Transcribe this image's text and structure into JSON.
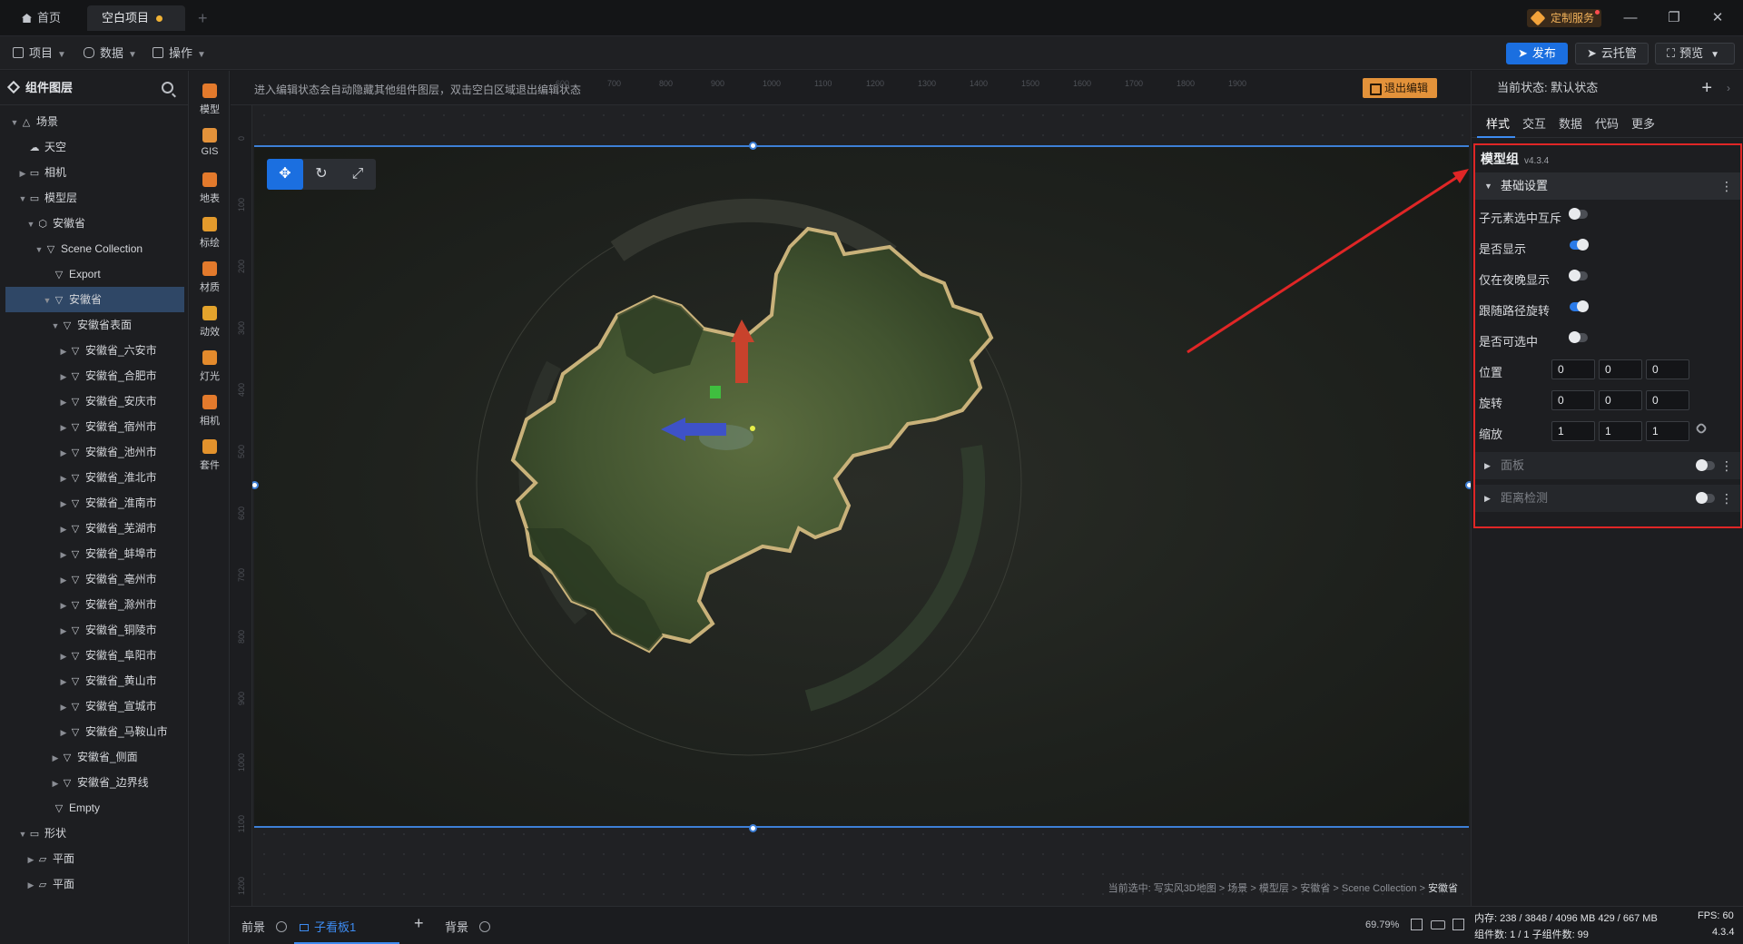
{
  "titlebar": {
    "home_tab": "首页",
    "project_tab": "空白项目",
    "add_tab": "+",
    "custom_service": "定制服务",
    "minimize": "—",
    "restore": "❐",
    "close": "✕",
    "colors": {
      "accent": "#1b6fe0",
      "unsaved_dot": "#f0b235"
    }
  },
  "menubar": {
    "project": "项目",
    "data": "数据",
    "operation": "操作",
    "publish": "发布",
    "cloud": "云托管",
    "preview": "预览"
  },
  "layer_panel": {
    "title": "组件图层",
    "items": [
      {
        "label": "场景",
        "arrow": "▼",
        "icon": "△"
      },
      {
        "label": "天空",
        "arrow": "",
        "icon": "☁"
      },
      {
        "label": "相机",
        "arrow": "▶",
        "icon": "▭"
      },
      {
        "label": "模型层",
        "arrow": "▼",
        "icon": "▭"
      },
      {
        "label": "安徽省",
        "arrow": "▼",
        "icon": "⬡"
      },
      {
        "label": "Scene Collection",
        "arrow": "▼",
        "icon": "▽"
      },
      {
        "label": "Export",
        "arrow": "",
        "icon": "▽"
      },
      {
        "label": "安徽省",
        "arrow": "▼",
        "icon": "▽"
      },
      {
        "label": "安徽省表面",
        "arrow": "▼",
        "icon": "▽"
      },
      {
        "label": "安徽省_六安市",
        "arrow": "▶",
        "icon": "▽"
      },
      {
        "label": "安徽省_合肥市",
        "arrow": "▶",
        "icon": "▽"
      },
      {
        "label": "安徽省_安庆市",
        "arrow": "▶",
        "icon": "▽"
      },
      {
        "label": "安徽省_宿州市",
        "arrow": "▶",
        "icon": "▽"
      },
      {
        "label": "安徽省_池州市",
        "arrow": "▶",
        "icon": "▽"
      },
      {
        "label": "安徽省_淮北市",
        "arrow": "▶",
        "icon": "▽"
      },
      {
        "label": "安徽省_淮南市",
        "arrow": "▶",
        "icon": "▽"
      },
      {
        "label": "安徽省_芜湖市",
        "arrow": "▶",
        "icon": "▽"
      },
      {
        "label": "安徽省_蚌埠市",
        "arrow": "▶",
        "icon": "▽"
      },
      {
        "label": "安徽省_亳州市",
        "arrow": "▶",
        "icon": "▽"
      },
      {
        "label": "安徽省_滁州市",
        "arrow": "▶",
        "icon": "▽"
      },
      {
        "label": "安徽省_铜陵市",
        "arrow": "▶",
        "icon": "▽"
      },
      {
        "label": "安徽省_阜阳市",
        "arrow": "▶",
        "icon": "▽"
      },
      {
        "label": "安徽省_黄山市",
        "arrow": "▶",
        "icon": "▽"
      },
      {
        "label": "安徽省_宣城市",
        "arrow": "▶",
        "icon": "▽"
      },
      {
        "label": "安徽省_马鞍山市",
        "arrow": "▶",
        "icon": "▽"
      },
      {
        "label": "安徽省_侧面",
        "arrow": "▶",
        "icon": "▽"
      },
      {
        "label": "安徽省_边界线",
        "arrow": "▶",
        "icon": "▽"
      },
      {
        "label": "Empty",
        "arrow": "",
        "icon": "▽"
      },
      {
        "label": "形状",
        "arrow": "▼",
        "icon": "▭"
      },
      {
        "label": "平面",
        "arrow": "▶",
        "icon": "▱"
      },
      {
        "label": "平面",
        "arrow": "▶",
        "icon": "▱"
      }
    ]
  },
  "toolbox": [
    "模型",
    "GIS",
    "地表",
    "标绘",
    "材质",
    "动效",
    "灯光",
    "相机",
    "套件"
  ],
  "canvas": {
    "edit_hint": "进入编辑状态会自动隐藏其他组件图层，双击空白区域退出编辑状态",
    "exit_edit": "退出编辑",
    "ruler_top": [
      "600",
      "700",
      "800",
      "900",
      "1000",
      "1100",
      "1200",
      "1300",
      "1400",
      "1500",
      "1600",
      "1700",
      "1800",
      "1900"
    ],
    "ruler_left": [
      "0",
      "100",
      "200",
      "300",
      "400",
      "500",
      "600",
      "700",
      "800",
      "900",
      "1000",
      "1100",
      "1200"
    ],
    "breadcrumb_prefix": "当前选中: 写实风3D地图 > 场景 > 模型层 > 安徽省 > Scene Collection >",
    "breadcrumb_current": "安徽省"
  },
  "bottombar": {
    "foreground": "前景",
    "subboard": "子看板1",
    "add": "+",
    "background": "背景",
    "zoom": "69.79%"
  },
  "right_panel": {
    "state_label": "当前状态:  默认状态",
    "tabs": [
      "样式",
      "交互",
      "数据",
      "代码",
      "更多"
    ],
    "component_title": "模型组",
    "version": "v4.3.4",
    "section_basic": "基础设置",
    "props": [
      {
        "label": "子元素选中互斥",
        "on": false
      },
      {
        "label": "是否显示",
        "on": true
      },
      {
        "label": "仅在夜晚显示",
        "on": false
      },
      {
        "label": "跟随路径旋转",
        "on": true
      },
      {
        "label": "是否可选中",
        "on": false
      }
    ],
    "position_label": "位置",
    "position": [
      "0",
      "0",
      "0"
    ],
    "rotation_label": "旋转",
    "rotation": [
      "0",
      "0",
      "0"
    ],
    "scale_label": "缩放",
    "scale": [
      "1",
      "1",
      "1"
    ],
    "section_panel": "面板",
    "section_distance": "距离检测"
  },
  "status": {
    "memory": "内存:  238 / 3848 / 4096 MB  429 / 667 MB",
    "fps": "FPS:  60",
    "components": "组件数: 1 / 1   子组件数: 99",
    "version": "4.3.4"
  }
}
